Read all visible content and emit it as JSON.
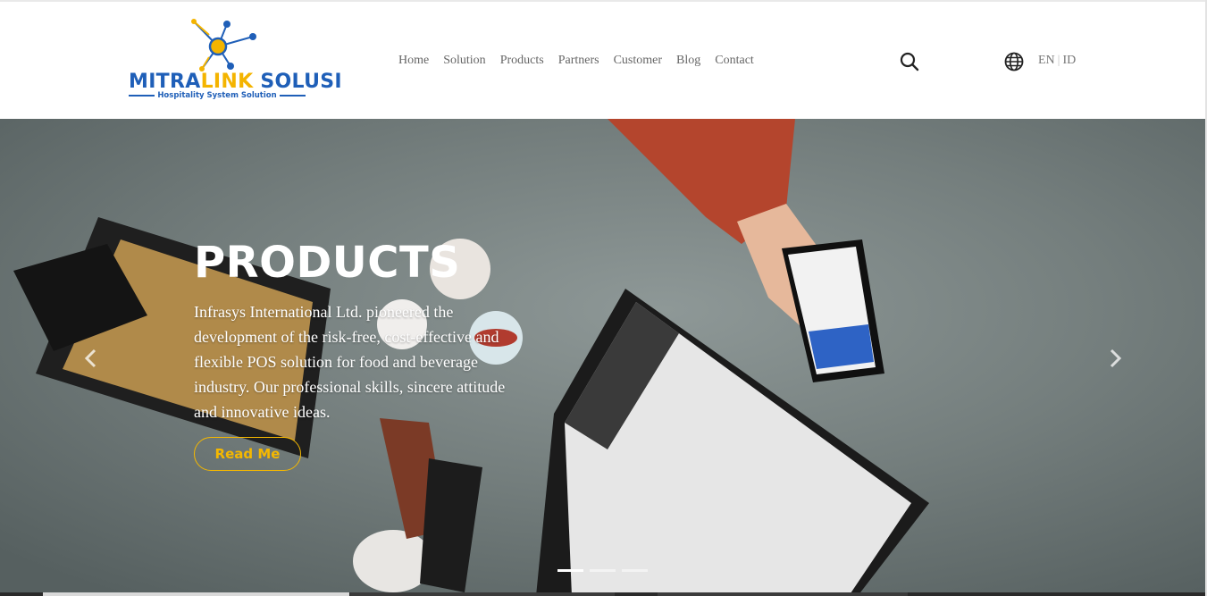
{
  "brand": {
    "word_part1": "MITRA",
    "word_part2": "LINK",
    "word_part3": " SOLUSI",
    "tagline": "Hospitality System Solution",
    "colors": {
      "blue": "#1f5fb8",
      "yellow": "#f4b400"
    }
  },
  "nav": {
    "items": [
      {
        "label": "Home"
      },
      {
        "label": "Solution"
      },
      {
        "label": "Products"
      },
      {
        "label": "Partners"
      },
      {
        "label": "Customer"
      },
      {
        "label": "Blog"
      },
      {
        "label": "Contact"
      }
    ]
  },
  "header": {
    "search_icon": "search-icon",
    "globe_icon": "globe-icon",
    "lang_en": "EN",
    "lang_sep": "|",
    "lang_id": "ID"
  },
  "hero": {
    "title": "PRODUCTS",
    "text": "Infrasys International Ltd. pioneered the development of the risk-free, cost-effective and flexible POS solution for food and beverage industry. Our professional skills, sincere attitude and innovative ideas.",
    "button_label": "Read Me",
    "accent_color": "#f5b800",
    "slide_count": 3,
    "active_slide": 1
  }
}
